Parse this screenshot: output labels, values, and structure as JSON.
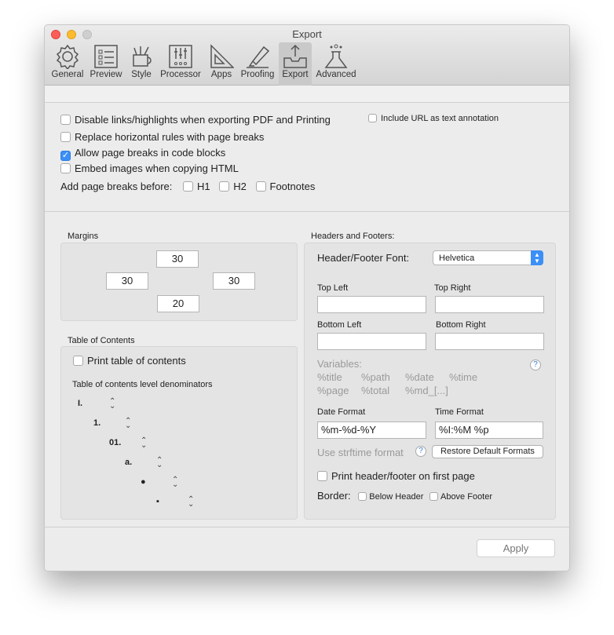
{
  "window": {
    "title": "Export"
  },
  "toolbar": [
    {
      "label": "General",
      "icon": "gear-icon"
    },
    {
      "label": "Preview",
      "icon": "list-icon"
    },
    {
      "label": "Style",
      "icon": "pencil-cup-icon"
    },
    {
      "label": "Processor",
      "icon": "sliders-icon"
    },
    {
      "label": "Apps",
      "icon": "triangle-ruler-icon"
    },
    {
      "label": "Proofing",
      "icon": "highlighter-icon"
    },
    {
      "label": "Export",
      "icon": "tray-upload-icon"
    },
    {
      "label": "Advanced",
      "icon": "flask-icon"
    }
  ],
  "options": {
    "disable_links": {
      "label": "Disable links/highlights when exporting PDF and Printing",
      "checked": false
    },
    "include_url": {
      "label": "Include URL as text annotation",
      "checked": false
    },
    "replace_rules": {
      "label": "Replace horizontal rules with page breaks",
      "checked": false
    },
    "allow_breaks": {
      "label": "Allow page breaks in code blocks",
      "checked": true
    },
    "embed_images": {
      "label": "Embed images when copying HTML",
      "checked": false
    },
    "page_breaks_label": "Add page breaks before:",
    "h1": "H1",
    "h2": "H2",
    "footnotes": "Footnotes"
  },
  "margins": {
    "title": "Margins",
    "top": "30",
    "left": "30",
    "right": "30",
    "bottom": "20"
  },
  "toc": {
    "title": "Table of Contents",
    "print_label": "Print table of contents",
    "denominators_label": "Table of contents level denominators",
    "levels": [
      "I.",
      "1.",
      "01.",
      "a.",
      "●",
      "▪"
    ]
  },
  "hf": {
    "title": "Headers and Footers:",
    "font_label": "Header/Footer Font:",
    "font_value": "Helvetica",
    "top_left": "Top Left",
    "top_right": "Top Right",
    "bottom_left": "Bottom Left",
    "bottom_right": "Bottom Right",
    "variables_label": "Variables:",
    "variables_row1": [
      "%title",
      "%path",
      "%date",
      "%time"
    ],
    "variables_row2": [
      "%page",
      "%total",
      "%md_[...]"
    ],
    "date_label": "Date Format",
    "date_value": "%m-%d-%Y",
    "time_label": "Time Format",
    "time_value": "%I:%M %p",
    "strftime": "Use strftime format",
    "restore": "Restore Default Formats",
    "first_page": "Print header/footer on first page",
    "border_label": "Border:",
    "below_header": "Below Header",
    "above_footer": "Above Footer",
    "help": "?"
  },
  "apply": "Apply"
}
